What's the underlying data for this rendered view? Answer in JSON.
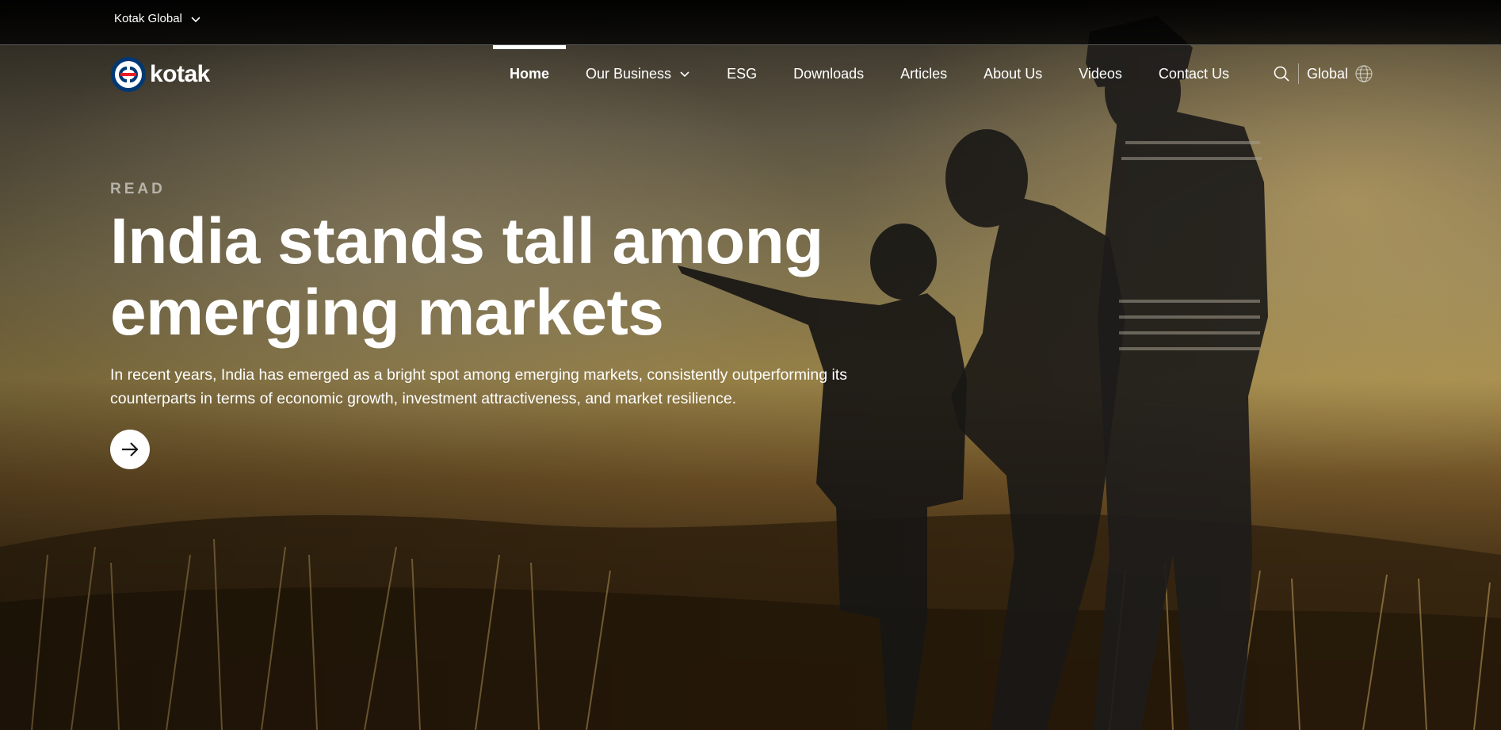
{
  "utility_bar": {
    "region_label": "Kotak Global"
  },
  "brand": {
    "name": "kotak",
    "logo_colors": {
      "primary": "#003874",
      "accent": "#ED1C24"
    }
  },
  "nav": {
    "items": [
      {
        "label": "Home",
        "active": true
      },
      {
        "label": "Our Business",
        "has_dropdown": true
      },
      {
        "label": "ESG"
      },
      {
        "label": "Downloads"
      },
      {
        "label": "Articles"
      },
      {
        "label": "About Us"
      },
      {
        "label": "Videos"
      },
      {
        "label": "Contact Us"
      }
    ],
    "search_icon": "search-icon",
    "global_label": "Global",
    "globe_icon": "globe-icon"
  },
  "hero": {
    "eyebrow": "READ",
    "headline": "India stands tall among emerging markets",
    "description": "In recent years, India has emerged as a bright spot among emerging markets, consistently outperforming its counterparts in terms of economic growth, investment attractiveness, and market resilience.",
    "cta_icon": "arrow-right-icon"
  }
}
